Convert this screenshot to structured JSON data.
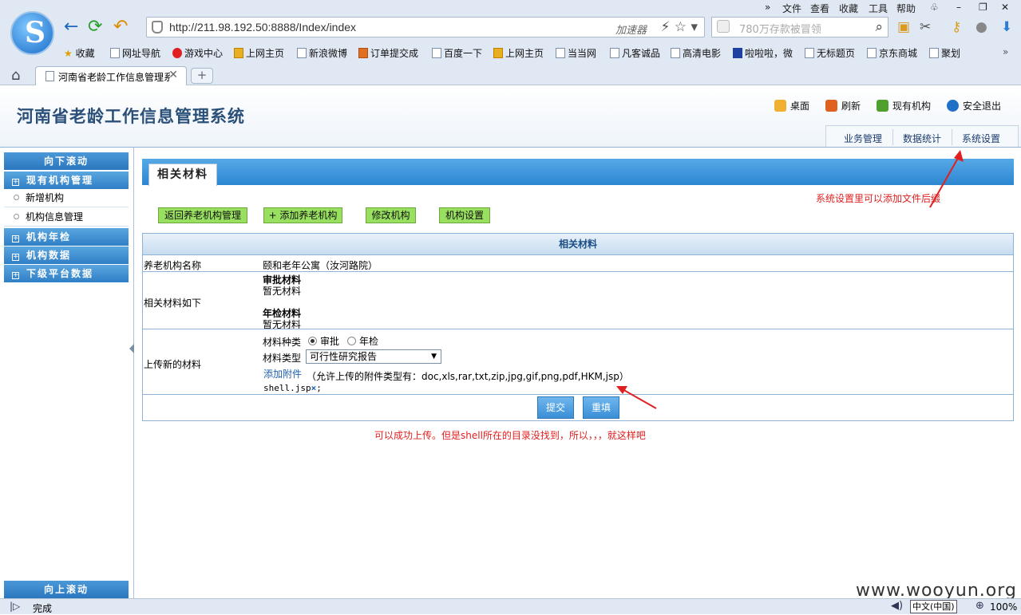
{
  "browser": {
    "menus": [
      "文件",
      "查看",
      "收藏",
      "工具",
      "帮助"
    ],
    "url": "http://211.98.192.50:8888/Index/index",
    "accelerator": "加速器",
    "search_placeholder": "780万存款被冒领",
    "bookmarks": [
      "收藏",
      "网址导航",
      "游戏中心",
      "上网主页",
      "新浪微博",
      "订单提交成",
      "百度一下",
      "上网主页",
      "当当网",
      "凡客诚品",
      "高清电影",
      "啦啦啦，微",
      "无标题页",
      "京东商城",
      "聚划"
    ],
    "tab_title": "河南省老龄工作信息管理系统",
    "status": "完成",
    "ime": "中文(中国)",
    "zoom": "100%"
  },
  "header": {
    "title": "河南省老龄工作信息管理系统",
    "links": [
      "桌面",
      "刷新",
      "现有机构",
      "安全退出"
    ],
    "nav": [
      "业务管理",
      "数据统计",
      "系统设置"
    ]
  },
  "sidebar": {
    "scroll_down": "向下滚动",
    "scroll_up": "向上滚动",
    "groups": [
      "现有机构管理",
      "机构年检",
      "机构数据",
      "下级平台数据"
    ],
    "items": [
      "新增机构",
      "机构信息管理"
    ]
  },
  "main": {
    "tab_title": "相关材料",
    "buttons": [
      "返回养老机构管理",
      "+ 添加养老机构",
      "修改机构",
      "机构设置"
    ],
    "note_top": "系统设置里可以添加文件后缀",
    "table": {
      "header": "相关材料",
      "name_label": "养老机构名称",
      "name_value": "颐和老年公寓（汝河路院）",
      "materials_label": "相关材料如下",
      "approval_title": "审批材料",
      "approval_value": "暂无材料",
      "annual_title": "年检材料",
      "annual_value": "暂无材料",
      "upload_label": "上传新的材料",
      "kind_label": "材料种类",
      "kind_opt1": "审批",
      "kind_opt2": "年检",
      "type_label": "材料类型",
      "type_value": "可行性研究报告",
      "add_attach": "添加附件",
      "allowed": "（允许上传的附件类型有：doc,xls,rar,txt,zip,jpg,gif,png,pdf,HKM,jsp）",
      "file": "shell.jsp",
      "file_suffix": ";",
      "submit": "提交",
      "reset": "重填"
    },
    "note_bottom": "可以成功上传。但是shell所在的目录没找到，所以，，，就这样吧"
  },
  "watermark": "www.wooyun.org",
  "colors": {
    "accent": "#2c86d0",
    "note": "#e02020",
    "button": "#99e060"
  }
}
